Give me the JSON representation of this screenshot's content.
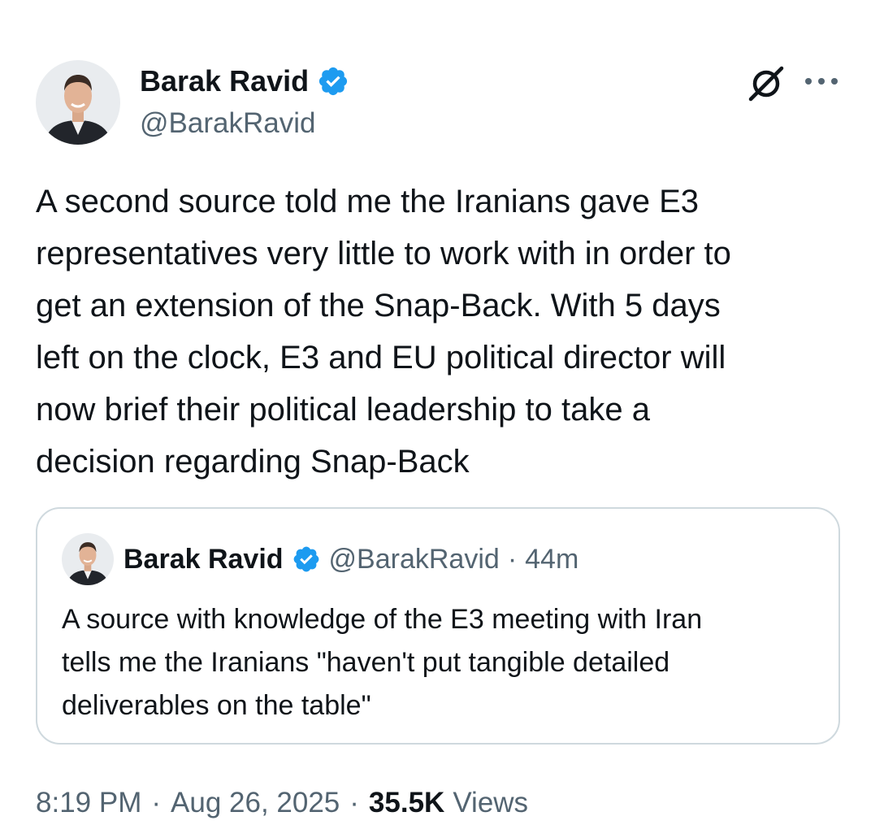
{
  "author": {
    "name": "Barak Ravid",
    "handle": "@BarakRavid"
  },
  "tweet": {
    "text": "A second source told me the Iranians gave E3\nrepresentatives very little to work with in order to\nget an extension of the Snap-Back. With 5 days\nleft on the clock, E3 and EU political director will\nnow brief their political leadership to take a\ndecision regarding Snap-Back"
  },
  "quote": {
    "name": "Barak Ravid",
    "handle": "@BarakRavid",
    "separator": "·",
    "time": "44m",
    "text": "A source with knowledge of the E3 meeting with Iran\ntells me the Iranians \"haven't put tangible detailed\ndeliverables on the table\""
  },
  "meta": {
    "time": "8:19 PM",
    "separator": "·",
    "date": "Aug 26, 2025",
    "views_count": "35.5K",
    "views_label": "Views"
  },
  "icons": {
    "verified": "verified-badge-icon",
    "grok": "grok-icon",
    "more": "more-options-icon"
  },
  "colors": {
    "verified": "#1d9bf0",
    "text_primary": "#0f1419",
    "text_secondary": "#536471",
    "border": "#cfd9de"
  }
}
